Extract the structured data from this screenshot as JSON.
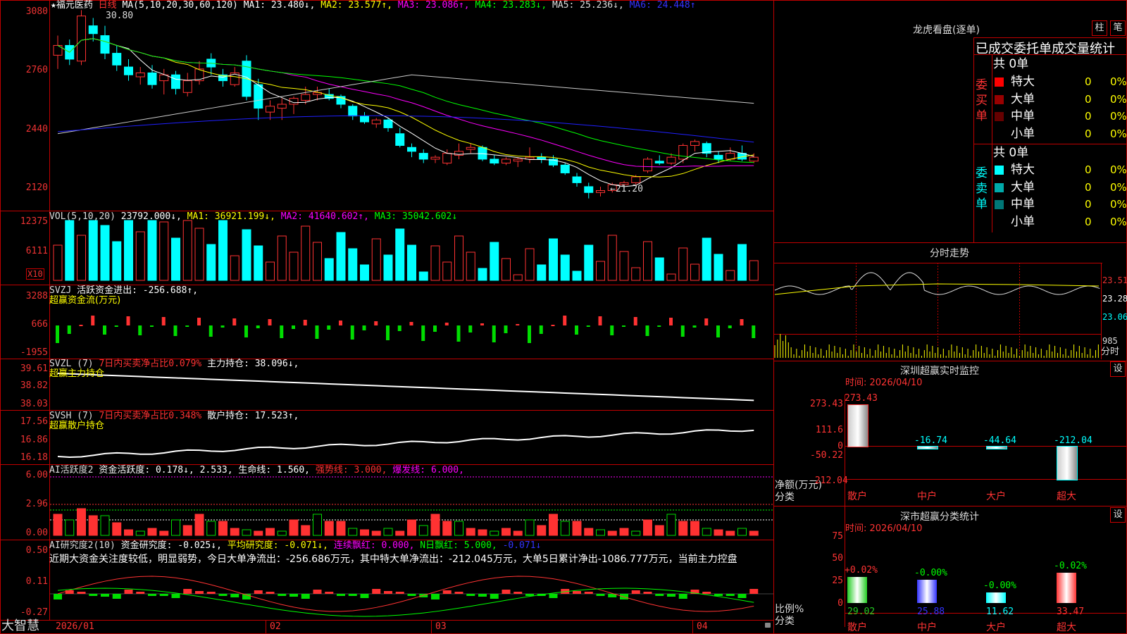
{
  "colors": {
    "up": "#ff3232",
    "down": "#00ffff",
    "flow_down": "#00dd00",
    "ma1": "#ffffff",
    "ma2": "#ffff00",
    "ma3": "#ff00ff",
    "ma4": "#00ff00",
    "ma5": "#cccccc",
    "ma6": "#2020ff",
    "border": "#c00000",
    "label_red": "#ff3333",
    "label_yellow": "#ffff00",
    "label_magenta": "#ff00ff",
    "label_green": "#00ff00",
    "label_blue": "#3333ff",
    "label_cyan": "#00ffff"
  },
  "main": {
    "star": "★",
    "stock_name": "福元医药",
    "period": "日线",
    "ma_params": "MA(5,10,20,30,60,120)",
    "ma1": "MA1: 23.480↓,",
    "ma2": "MA2: 23.577↑,",
    "ma3": "MA3: 23.086↑,",
    "ma4": "MA4: 23.283↓,",
    "ma5": "MA5: 25.236↓,",
    "ma6": "MA6: 24.448↑",
    "high_mark": "30.80",
    "low_mark": "←21.20",
    "y_labels": [
      "3080",
      "2760",
      "2440",
      "2120"
    ]
  },
  "vol": {
    "title": "VOL(5,10,20)",
    "value": "23792.000↓,",
    "ma1": "MA1: 36921.199↓,",
    "ma2": "MA2: 41640.602↑,",
    "ma3": "MA3: 35042.602↓",
    "y_labels": [
      "12375",
      "6111"
    ],
    "unit": "X10"
  },
  "svzj": {
    "title": "SVZJ",
    "label": "活跃资金进出: -256.688↑,",
    "subtitle": "超赢资金流(万元)",
    "y_labels": [
      "3288",
      "666",
      "-1955"
    ]
  },
  "svzl": {
    "title": "SVZL (7)",
    "label1": "7日内买卖净占比0.079%",
    "label2": "主力持仓: 38.096↓,",
    "subtitle": "超赢主力持仓",
    "y_labels": [
      "39.61",
      "38.82",
      "38.03"
    ]
  },
  "svsh": {
    "title": "SVSH (7)",
    "label1": "7日内买卖净占比0.348%",
    "label2": "散户持仓: 17.523↑,",
    "subtitle": "超赢散户持仓",
    "y_labels": [
      "17.56",
      "16.86",
      "16.18"
    ]
  },
  "ai_active": {
    "title": "AI活跃度2",
    "label1": "资金活跃度: 0.178↓,",
    "label2": "2.533,",
    "label3": "生命线: 1.560,",
    "label4": "强势线: 3.000,",
    "label5": "爆发线: 6.000,",
    "y_labels": [
      "6.00",
      "2.96",
      "0.00"
    ]
  },
  "ai_research": {
    "title": "AI研究度2(10)",
    "label1": "资金研究度: -0.025↓,",
    "label2": "平均研究度: -0.071↓,",
    "label3": "连续飘红: 0.000,",
    "label4": "N日飘红: 5.000,",
    "label5": "-0.071↓",
    "comment": "近期大资金关注度较低，明显弱势，今日大单净流出：-256.686万元，其中特大单净流出：-212.045万元，大单5日累计净出-1086.777万元，当前主力控盘",
    "y_labels": [
      "0.50",
      "0.11",
      "-0.27"
    ]
  },
  "x_axis": [
    "2026/01",
    "02",
    "03",
    "04"
  ],
  "bottom_logo": "大智慧",
  "right": {
    "longhu_title": "龙虎看盘(逐单)",
    "btn_zhu": "柱",
    "btn_bi": "笔",
    "header": "已成交委托单成交量统计",
    "buy_label": "委买单",
    "sell_label": "委卖单",
    "buy_total": "共 0单",
    "sell_total": "共 0单",
    "buy_rows": [
      {
        "name": "特大",
        "count": "0",
        "pct": "0%",
        "color": "#ff0000"
      },
      {
        "name": "大单",
        "count": "0",
        "pct": "0%",
        "color": "#990000"
      },
      {
        "name": "中单",
        "count": "0",
        "pct": "0%",
        "color": "#660000"
      },
      {
        "name": "小单",
        "count": "0",
        "pct": "0%",
        "color": "#000000"
      }
    ],
    "sell_rows": [
      {
        "name": "特大",
        "count": "0",
        "pct": "0%",
        "color": "#00ffff"
      },
      {
        "name": "大单",
        "count": "0",
        "pct": "0%",
        "color": "#00aaaa"
      },
      {
        "name": "中单",
        "count": "0",
        "pct": "0%",
        "color": "#007777"
      },
      {
        "name": "小单",
        "count": "0",
        "pct": "0%",
        "color": "#000000"
      }
    ],
    "intraday_title": "分时走势",
    "intraday_y": [
      "23.51",
      "23.28",
      "23.06"
    ],
    "intraday_vol": "985",
    "intraday_unit": "分时",
    "sz_monitor_title": "深圳超赢实时监控",
    "sz_monitor_btn": "设",
    "sz_monitor_time": "时间: 2026/04/10",
    "sz_monitor_y": [
      "273.43",
      "111.6",
      "0",
      "-50.22",
      "-212.04"
    ],
    "sz_monitor_axis_label": "净额(万元)",
    "sz_monitor_axis_label2": "分类",
    "sz_monitor_values": [
      "273.43",
      "-16.74",
      "-44.64",
      "-212.04"
    ],
    "sz_monitor_cats": [
      "散户",
      "中户",
      "大户",
      "超大"
    ],
    "sz_stat_title": "深市超赢分类统计",
    "sz_stat_btn": "设",
    "sz_stat_time": "时间: 2026/04/10",
    "sz_stat_y": [
      "75",
      "50",
      "25",
      "0"
    ],
    "sz_stat_axis_label": "比例%",
    "sz_stat_axis_label2": "分类",
    "sz_stat_changes": [
      "+0.02%",
      "-0.00%",
      "-0.00%",
      "-0.02%"
    ],
    "sz_stat_values": [
      "29.02",
      "25.88",
      "11.62",
      "33.47"
    ],
    "sz_stat_cats": [
      "散户",
      "中户",
      "大户",
      "超大"
    ]
  },
  "chart_data": {
    "type": "candlestick",
    "ylim": [
      2100,
      3100
    ],
    "high": 30.8,
    "low": 21.2,
    "candles": [
      [
        28.5,
        29.5,
        27.8,
        29.0
      ],
      [
        29.0,
        29.3,
        28.0,
        28.3
      ],
      [
        28.2,
        30.8,
        28.0,
        30.5
      ],
      [
        30.0,
        30.4,
        29.2,
        29.6
      ],
      [
        29.5,
        30.0,
        28.3,
        28.6
      ],
      [
        28.6,
        29.0,
        27.7,
        28.0
      ],
      [
        27.9,
        28.3,
        27.2,
        27.5
      ],
      [
        27.4,
        27.9,
        27.0,
        27.6
      ],
      [
        27.6,
        28.0,
        26.8,
        27.0
      ],
      [
        27.2,
        27.8,
        26.5,
        27.5
      ],
      [
        27.5,
        27.7,
        26.5,
        26.8
      ],
      [
        26.6,
        27.6,
        26.4,
        27.2
      ],
      [
        27.2,
        28.2,
        27.0,
        27.8
      ],
      [
        28.3,
        28.6,
        27.5,
        27.9
      ],
      [
        27.5,
        27.8,
        26.9,
        27.2
      ],
      [
        27.0,
        27.9,
        26.9,
        27.6
      ],
      [
        28.2,
        28.5,
        26.2,
        26.4
      ],
      [
        27.0,
        27.3,
        25.2,
        25.8
      ],
      [
        25.6,
        26.2,
        25.2,
        25.9
      ],
      [
        25.8,
        26.3,
        25.2,
        26.0
      ],
      [
        26.0,
        26.4,
        25.5,
        26.3
      ],
      [
        26.2,
        26.9,
        26.0,
        26.5
      ],
      [
        26.5,
        26.9,
        26.2,
        26.6
      ],
      [
        26.5,
        26.8,
        26.2,
        26.3
      ],
      [
        26.4,
        26.5,
        25.8,
        26.0
      ],
      [
        25.9,
        26.0,
        25.2,
        25.4
      ],
      [
        25.4,
        25.6,
        25.0,
        25.1
      ],
      [
        25.0,
        25.3,
        24.8,
        25.2
      ],
      [
        25.2,
        25.3,
        24.6,
        24.8
      ],
      [
        24.5,
        24.8,
        23.8,
        23.9
      ],
      [
        23.8,
        24.0,
        23.3,
        23.6
      ],
      [
        23.5,
        23.7,
        23.0,
        23.2
      ],
      [
        23.2,
        23.4,
        23.0,
        23.3
      ],
      [
        23.0,
        23.7,
        22.9,
        23.5
      ],
      [
        23.4,
        24.0,
        23.2,
        23.6
      ],
      [
        23.7,
        24.0,
        23.5,
        23.8
      ],
      [
        23.8,
        23.9,
        23.1,
        23.2
      ],
      [
        23.2,
        23.4,
        22.9,
        23.0
      ],
      [
        23.0,
        23.3,
        22.9,
        23.2
      ],
      [
        23.1,
        23.3,
        22.8,
        23.2
      ],
      [
        23.2,
        23.8,
        23.0,
        23.3
      ],
      [
        23.3,
        23.5,
        23.0,
        23.2
      ],
      [
        23.2,
        23.4,
        22.8,
        22.9
      ],
      [
        22.9,
        23.0,
        22.4,
        22.5
      ],
      [
        22.3,
        22.5,
        21.8,
        22.0
      ],
      [
        21.8,
        22.0,
        21.2,
        21.5
      ],
      [
        21.5,
        21.8,
        21.3,
        21.6
      ],
      [
        21.6,
        22.0,
        21.5,
        21.9
      ],
      [
        21.9,
        22.1,
        21.7,
        22.0
      ],
      [
        22.0,
        22.4,
        21.9,
        22.3
      ],
      [
        22.6,
        23.3,
        22.5,
        23.2
      ],
      [
        23.1,
        23.4,
        22.9,
        23.0
      ],
      [
        23.0,
        23.5,
        22.9,
        23.3
      ],
      [
        23.2,
        24.0,
        23.0,
        23.9
      ],
      [
        23.9,
        24.2,
        23.6,
        24.1
      ],
      [
        24.0,
        24.1,
        23.3,
        23.5
      ],
      [
        23.4,
        23.6,
        23.0,
        23.2
      ],
      [
        23.2,
        23.8,
        23.1,
        23.5
      ],
      [
        23.5,
        23.9,
        23.1,
        23.2
      ],
      [
        23.1,
        23.5,
        23.0,
        23.3
      ]
    ]
  }
}
